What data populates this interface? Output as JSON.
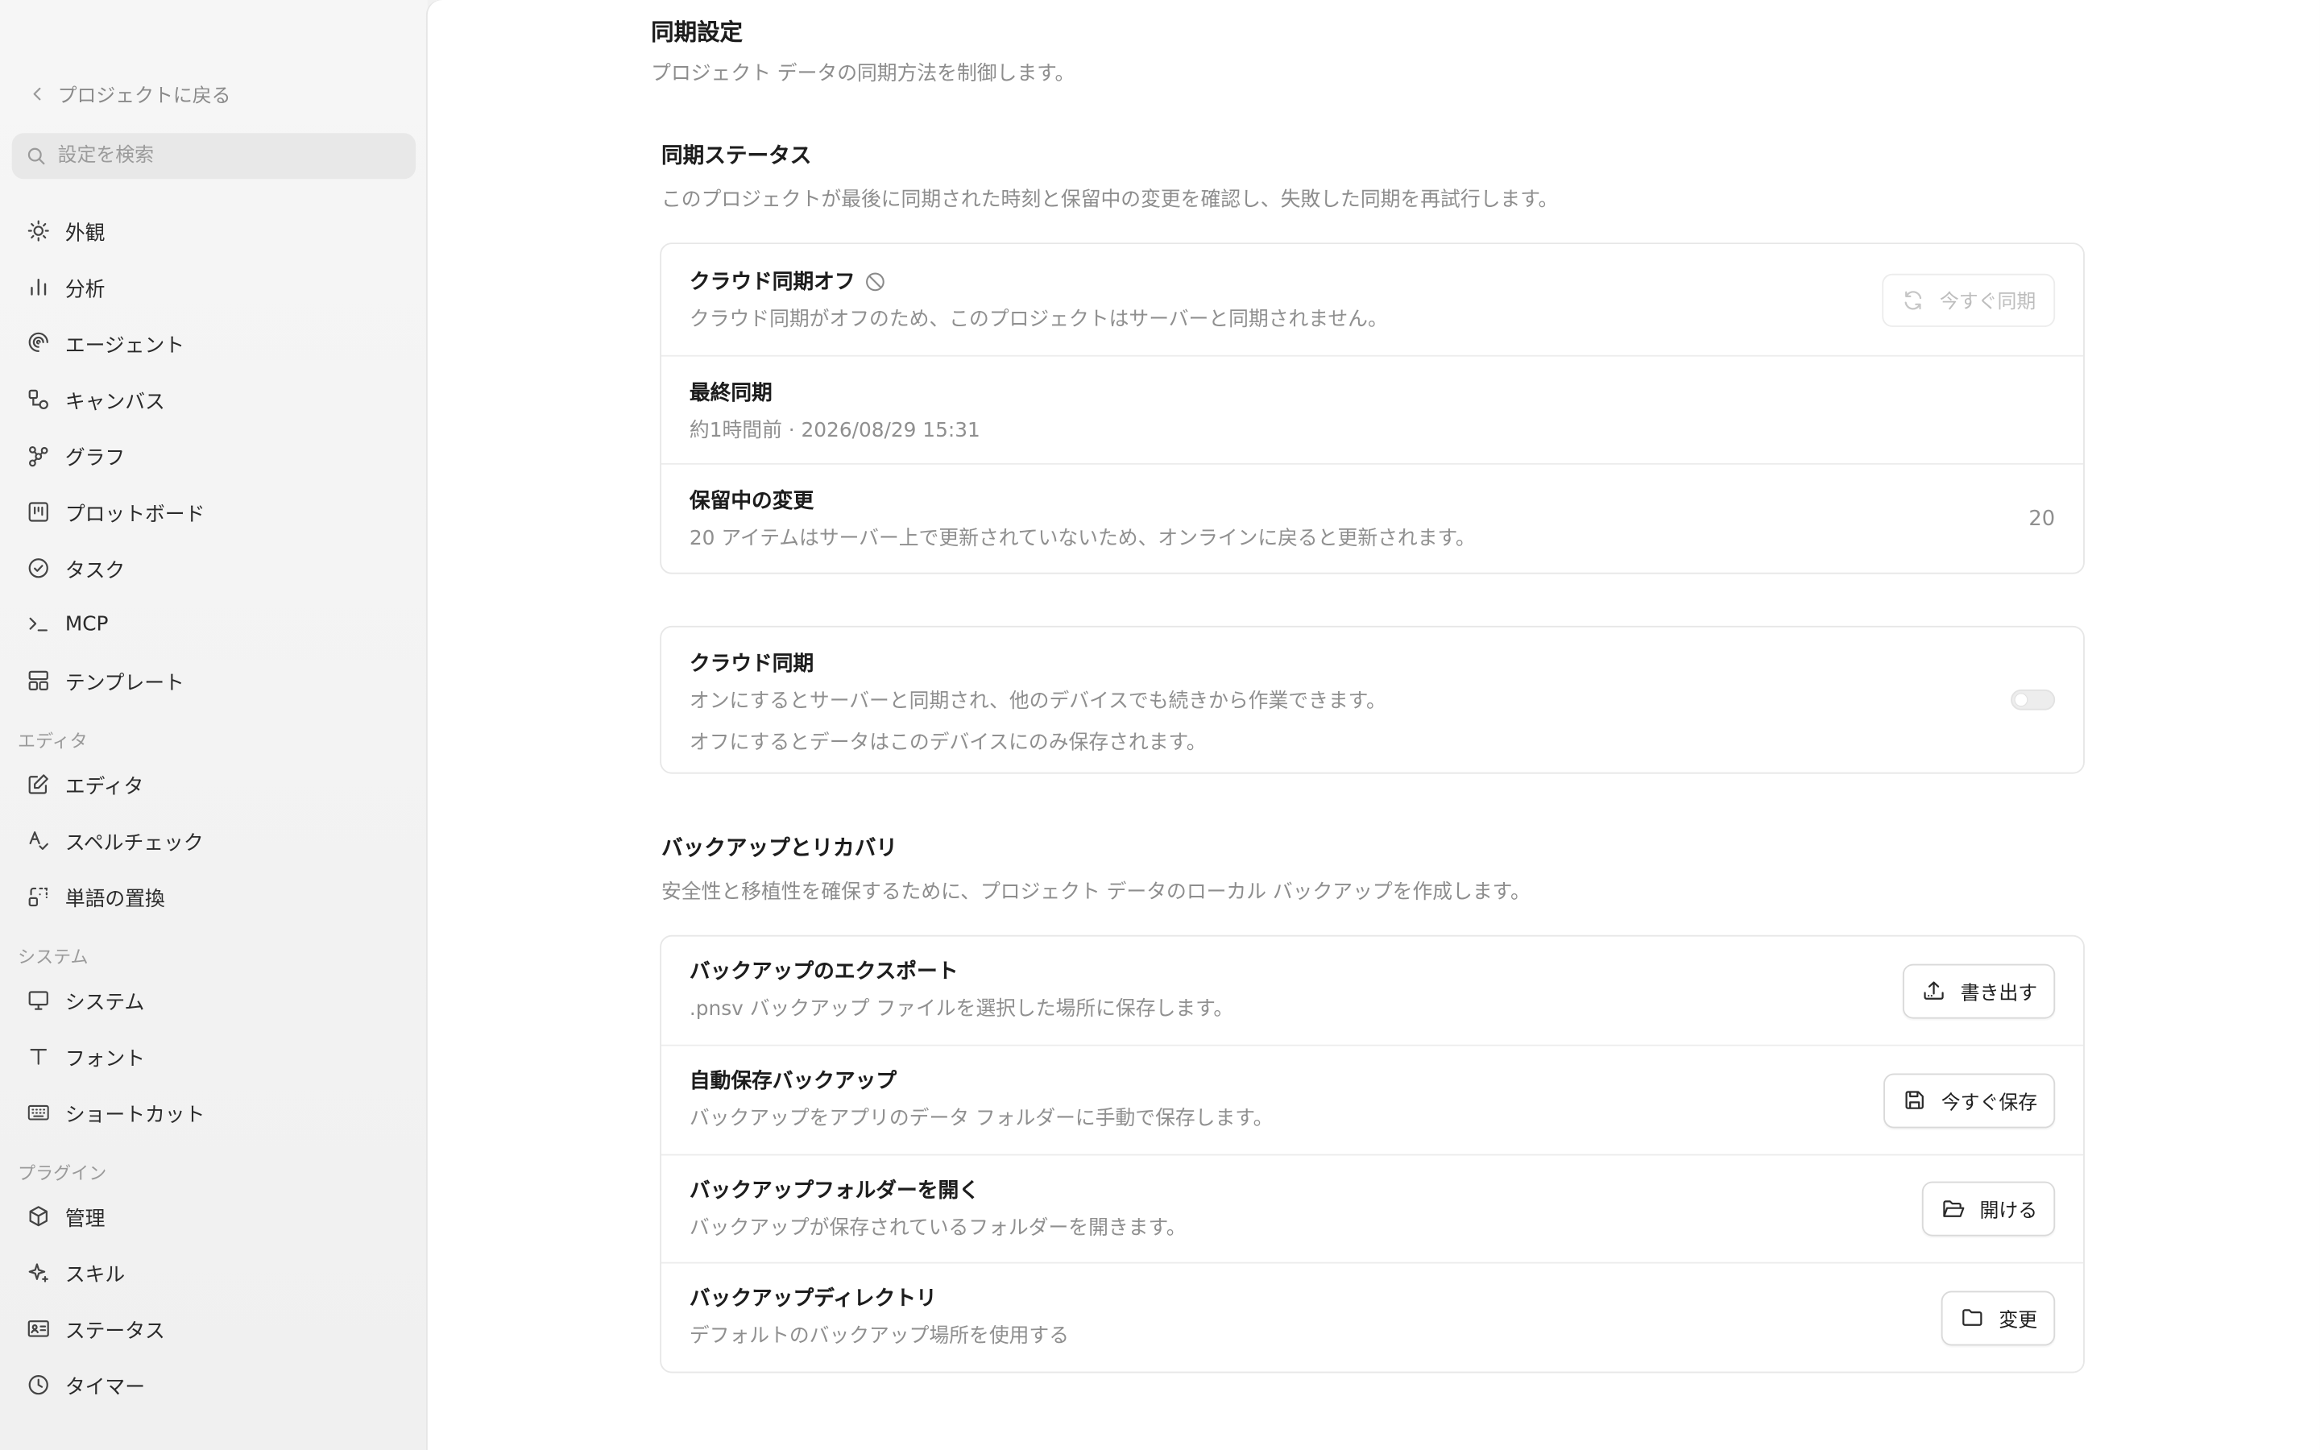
{
  "sidebar": {
    "back_label": "プロジェクトに戻る",
    "search_placeholder": "設定を検索",
    "items_main": [
      {
        "label": "外観",
        "icon": "sun-icon"
      },
      {
        "label": "分析",
        "icon": "bar-chart-icon"
      },
      {
        "label": "エージェント",
        "icon": "spiral-icon"
      },
      {
        "label": "キャンバス",
        "icon": "shapes-icon"
      },
      {
        "label": "グラフ",
        "icon": "graph-icon"
      },
      {
        "label": "プロットボード",
        "icon": "board-icon"
      },
      {
        "label": "タスク",
        "icon": "check-circle-icon"
      },
      {
        "label": "MCP",
        "icon": "terminal-icon"
      },
      {
        "label": "テンプレート",
        "icon": "template-icon"
      }
    ],
    "editor_section": "エディタ",
    "items_editor": [
      {
        "label": "エディタ",
        "icon": "edit-icon"
      },
      {
        "label": "スペルチェック",
        "icon": "spell-check-icon"
      },
      {
        "label": "単語の置換",
        "icon": "replace-icon"
      }
    ],
    "system_section": "システム",
    "items_system": [
      {
        "label": "システム",
        "icon": "monitor-icon"
      },
      {
        "label": "フォント",
        "icon": "type-icon"
      },
      {
        "label": "ショートカット",
        "icon": "keyboard-icon"
      }
    ],
    "plugins_section": "プラグイン",
    "items_plugins": [
      {
        "label": "管理",
        "icon": "package-icon"
      },
      {
        "label": "スキル",
        "icon": "sparkle-icon"
      },
      {
        "label": "ステータス",
        "icon": "id-card-icon"
      },
      {
        "label": "タイマー",
        "icon": "clock-icon"
      }
    ]
  },
  "main": {
    "title": "同期設定",
    "subtitle": "プロジェクト データの同期方法を制御します。",
    "sync_status": {
      "title": "同期ステータス",
      "subtitle": "このプロジェクトが最後に同期された時刻と保留中の変更を確認し、失敗した同期を再試行します。",
      "cloud_off_title": "クラウド同期オフ",
      "cloud_off_desc": "クラウド同期がオフのため、このプロジェクトはサーバーと同期されません。",
      "sync_now_label": "今すぐ同期",
      "last_sync_title": "最終同期",
      "last_sync_value": "約1時間前 · 2026/08/29 15:31",
      "pending_title": "保留中の変更",
      "pending_desc": "20 アイテムはサーバー上で更新されていないため、オンラインに戻ると更新されます。",
      "pending_count": "20"
    },
    "cloud_sync": {
      "title": "クラウド同期",
      "desc_line1": "オンにするとサーバーと同期され、他のデバイスでも続きから作業できます。",
      "desc_line2": "オフにするとデータはこのデバイスにのみ保存されます。",
      "enabled": false
    },
    "backup": {
      "title": "バックアップとリカバリ",
      "subtitle": "安全性と移植性を確保するために、プロジェクト データのローカル バックアップを作成します。",
      "export_title": "バックアップのエクスポート",
      "export_desc": ".pnsv バックアップ ファイルを選択した場所に保存します。",
      "export_button": "書き出す",
      "autosave_title": "自動保存バックアップ",
      "autosave_desc": "バックアップをアプリのデータ フォルダーに手動で保存します。",
      "autosave_button": "今すぐ保存",
      "open_folder_title": "バックアップフォルダーを開く",
      "open_folder_desc": "バックアップが保存されているフォルダーを開きます。",
      "open_folder_button": "開ける",
      "directory_title": "バックアップディレクトリ",
      "directory_desc": "デフォルトのバックアップ場所を使用する",
      "directory_button": "変更"
    }
  },
  "colors": {
    "sidebar_bg": "#f3f3f3",
    "main_bg": "#ffffff",
    "muted_text": "#8f8f8f",
    "border": "#e7e7e7"
  }
}
